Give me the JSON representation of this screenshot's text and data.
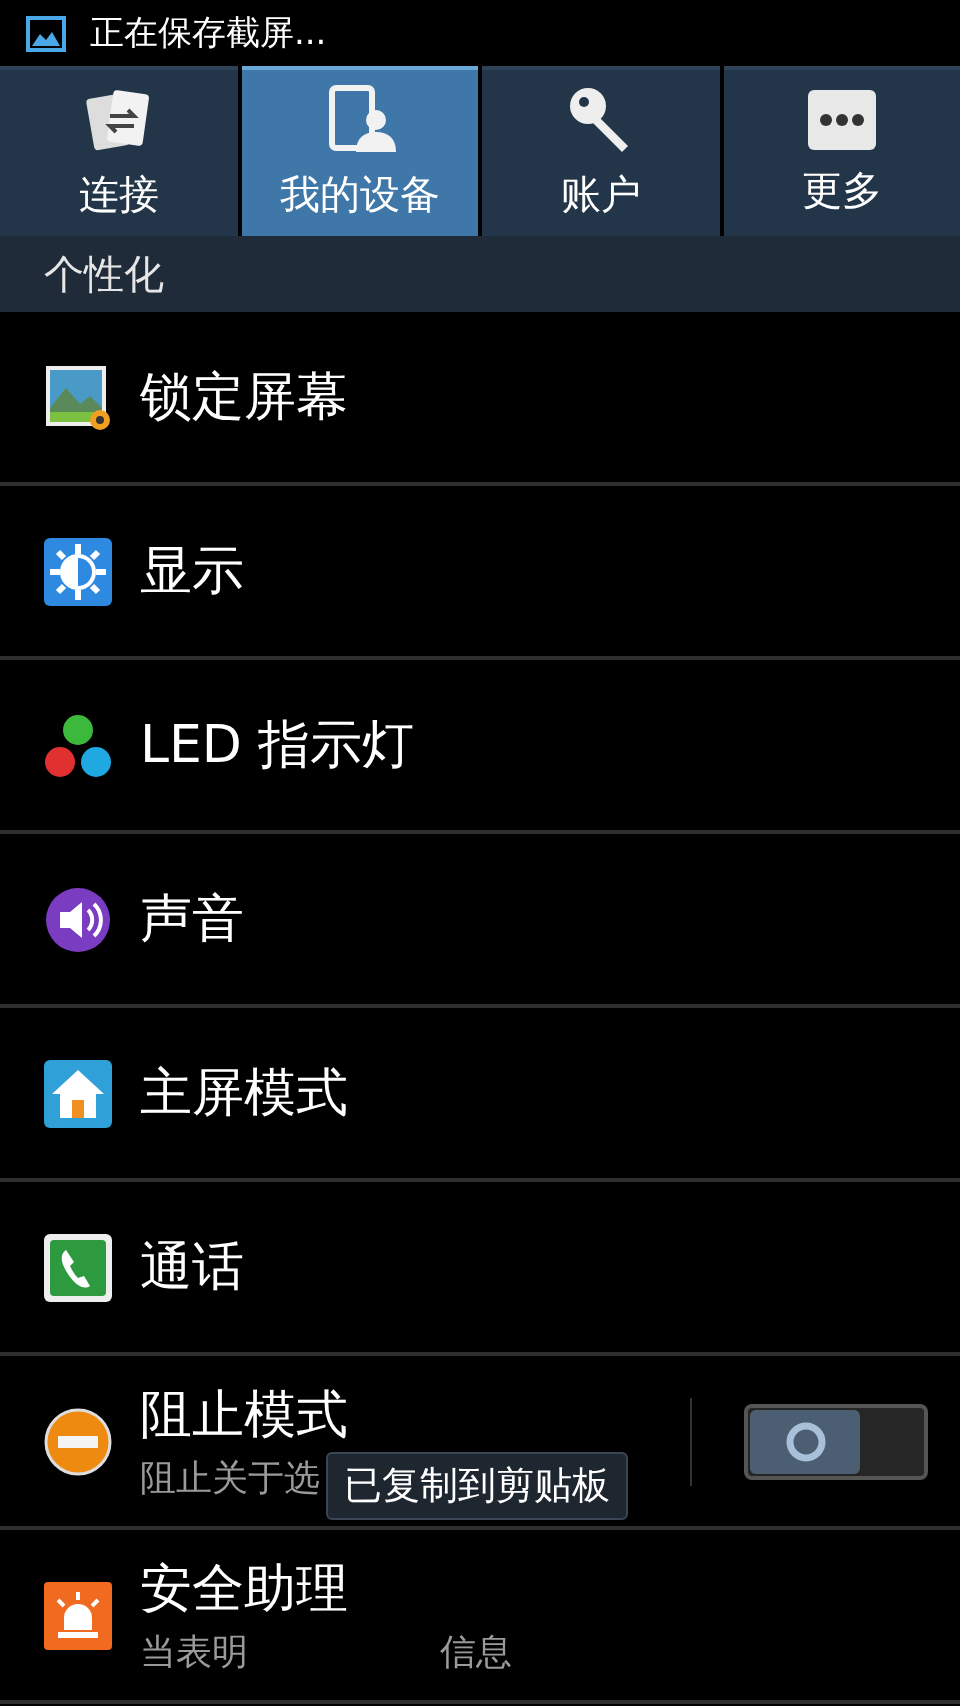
{
  "status_bar": {
    "notification": "正在保存截屏..."
  },
  "tabs": [
    {
      "label": "连接",
      "selected": false
    },
    {
      "label": "我的设备",
      "selected": true
    },
    {
      "label": "账户",
      "selected": false
    },
    {
      "label": "更多",
      "selected": false
    }
  ],
  "section": {
    "title": "个性化"
  },
  "items": [
    {
      "kind": "plain",
      "title": "锁定屏幕"
    },
    {
      "kind": "plain",
      "title": "显示"
    },
    {
      "kind": "plain",
      "title": "LED 指示灯"
    },
    {
      "kind": "plain",
      "title": "声音"
    },
    {
      "kind": "plain",
      "title": "主屏模式"
    },
    {
      "kind": "plain",
      "title": "通话"
    },
    {
      "kind": "toggle",
      "title": "阻止模式",
      "subtitle": "阻止关于选",
      "on": false
    },
    {
      "kind": "subtitle_split",
      "title": "安全助理",
      "subtitle_start": "当表明",
      "subtitle_end": "信息"
    }
  ],
  "toast": {
    "text": "已复制到剪贴板"
  }
}
